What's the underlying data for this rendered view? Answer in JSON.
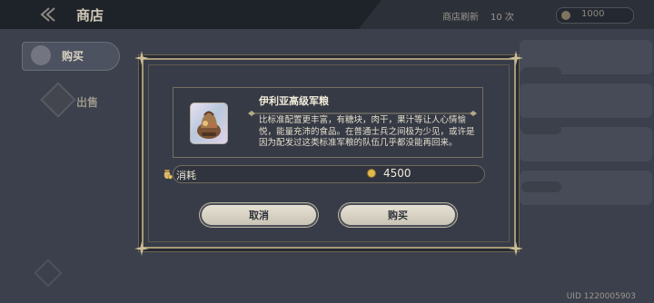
{
  "header": {
    "title": "商店",
    "refresh_label": "商店刷新",
    "refresh_count": "10 次",
    "currency_value": "1000"
  },
  "sidebar": {
    "items": [
      {
        "label": "购买",
        "icon": "cart-icon",
        "active": true
      },
      {
        "label": "出售",
        "icon": "sell-icon",
        "active": false
      }
    ]
  },
  "footer": {
    "uid": "UID 1220005903"
  },
  "dialog": {
    "item_name": "伊利亚高级军粮",
    "item_icon": "ration-bag-icon",
    "description": "比标准配置更丰富，有糖块，肉干，果汁等让人心情愉悦，能量充沛的食品。在普通士兵之间极为少见，或许是因为配发过这类标准军粮的队伍几乎都没能再回来。",
    "cost_label": "消耗",
    "cost_icon": "coin-bag-icon",
    "cost_value": "4500",
    "cancel_label": "取消",
    "buy_label": "购买"
  },
  "colors": {
    "background": "#3b404c",
    "dialog_background": "#383c48",
    "dialog_border": "#a79a78",
    "button_fill": "#e6e1d3",
    "coin": "#e0b84d"
  }
}
